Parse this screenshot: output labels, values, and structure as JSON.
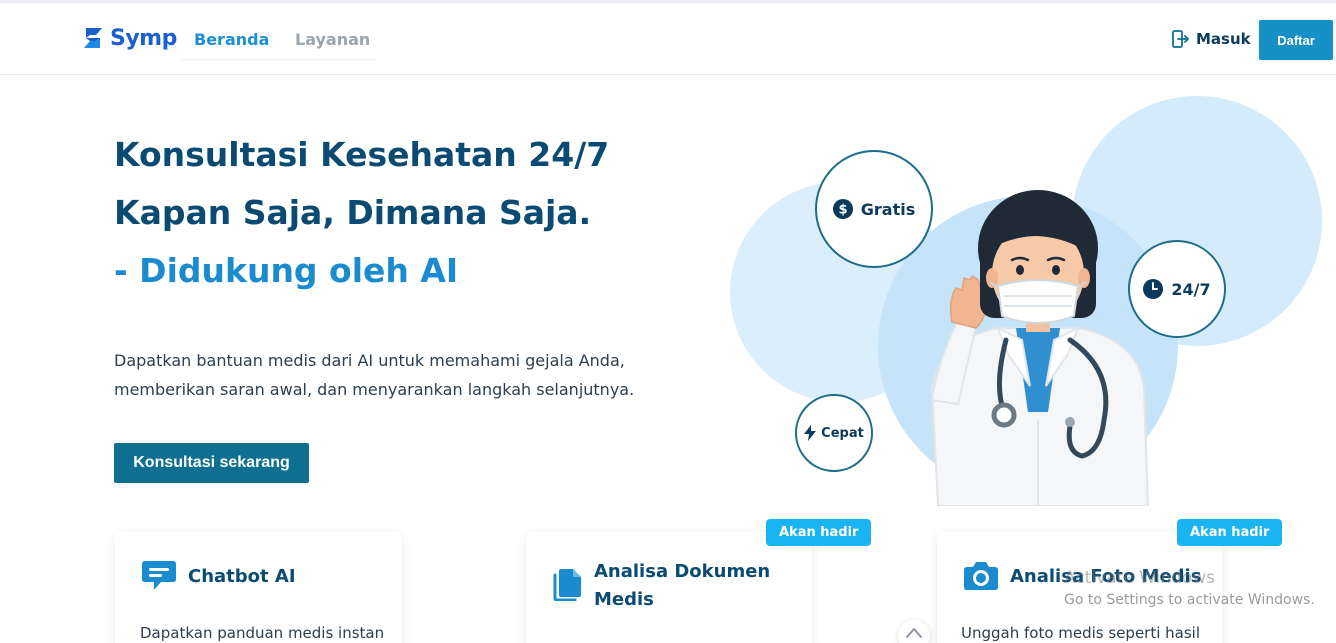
{
  "header": {
    "brand": "Symp",
    "nav": {
      "home": "Beranda",
      "services": "Layanan"
    },
    "login": "Masuk",
    "register": "Daftar"
  },
  "hero": {
    "line1": "Konsultasi Kesehatan 24/7",
    "line2": "Kapan Saja, Dimana Saja.",
    "line3": "- Didukung oleh AI",
    "description": "Dapatkan bantuan medis dari AI untuk memahami gejala Anda, memberikan saran awal, dan menyarankan langkah selanjutnya.",
    "cta": "Konsultasi sekarang"
  },
  "badges": {
    "free": "Gratis",
    "always": "24/7",
    "fast": "Cepat"
  },
  "features": [
    {
      "title": "Chatbot AI",
      "description": "Dapatkan panduan medis instan",
      "icon": "chat-icon"
    },
    {
      "title": "Analisa Dokumen Medis",
      "description": "",
      "icon": "document-icon",
      "tag": "Akan hadir"
    },
    {
      "title": "Analisa Foto Medis",
      "description": "Unggah foto medis seperti hasil",
      "icon": "camera-icon",
      "tag": "Akan hadir"
    }
  ],
  "watermark": {
    "title": "Activate Windows",
    "subtitle": "Go to Settings to activate Windows."
  },
  "colors": {
    "brand": "#1a5fd0",
    "navActive": "#1b8fd6",
    "heading": "#0b4b73",
    "accent": "#1b8bd0",
    "cta": "#0e6f91",
    "register": "#1790c8",
    "badge": "#1bb4f2"
  }
}
